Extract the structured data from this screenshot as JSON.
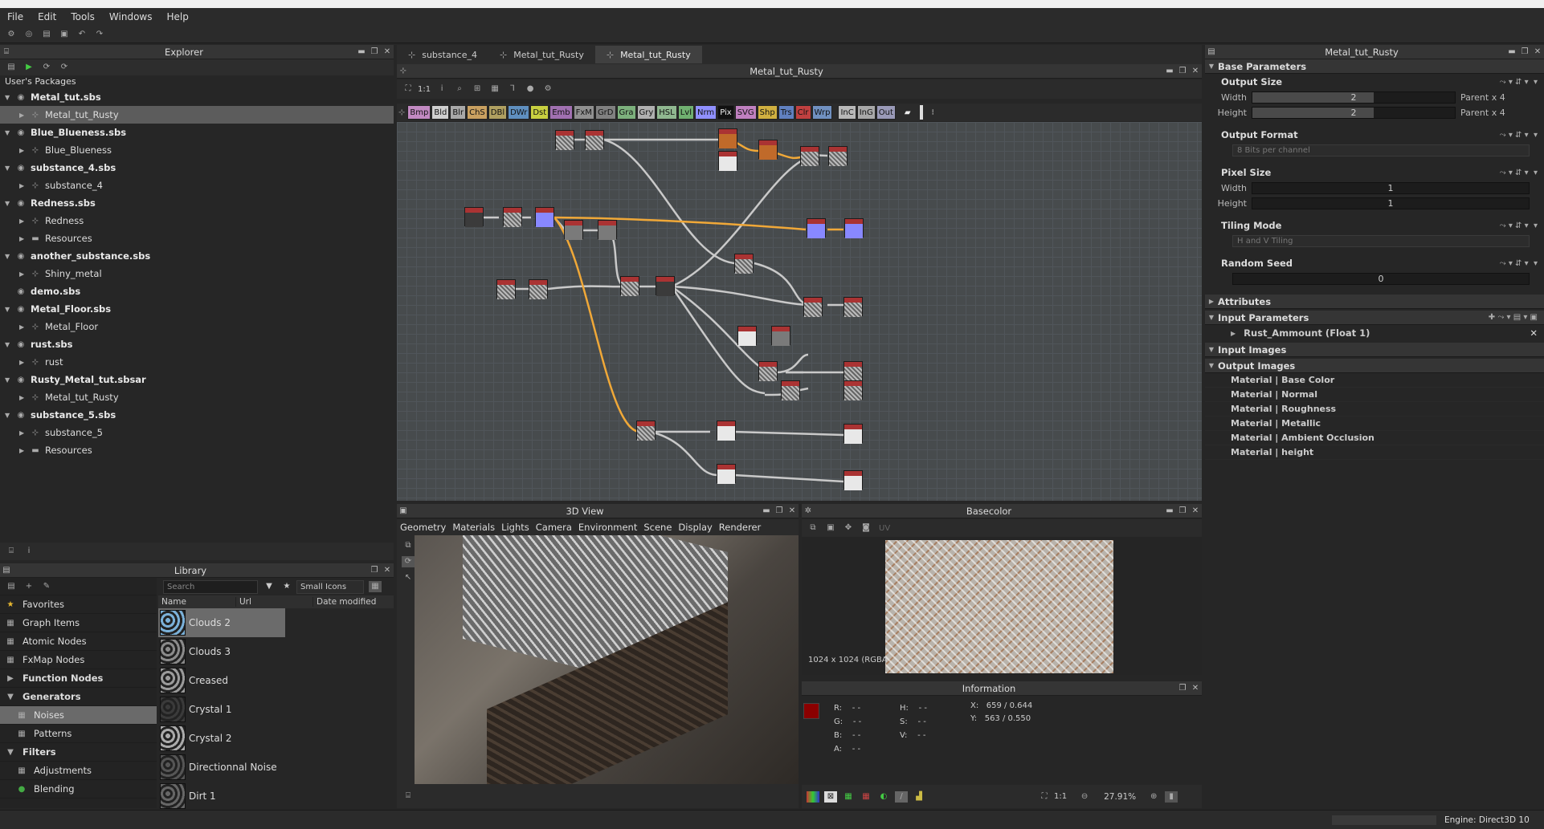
{
  "menu": [
    "File",
    "Edit",
    "Tools",
    "Windows",
    "Help"
  ],
  "explorer": {
    "title": "Explorer",
    "root": "User's Packages",
    "items": [
      {
        "label": "Metal_tut.sbs",
        "level": 0,
        "type": "pkg"
      },
      {
        "label": "Metal_tut_Rusty",
        "level": 1,
        "type": "graph",
        "selected": true
      },
      {
        "label": "Blue_Blueness.sbs",
        "level": 0,
        "type": "pkg"
      },
      {
        "label": "Blue_Blueness",
        "level": 1,
        "type": "graph"
      },
      {
        "label": "substance_4.sbs",
        "level": 0,
        "type": "pkg"
      },
      {
        "label": "substance_4",
        "level": 1,
        "type": "graph"
      },
      {
        "label": "Redness.sbs",
        "level": 0,
        "type": "pkg"
      },
      {
        "label": "Redness",
        "level": 1,
        "type": "graph"
      },
      {
        "label": "Resources",
        "level": 1,
        "type": "folder"
      },
      {
        "label": "another_substance.sbs",
        "level": 0,
        "type": "pkg"
      },
      {
        "label": "Shiny_metal",
        "level": 1,
        "type": "graph"
      },
      {
        "label": "demo.sbs",
        "level": 0,
        "type": "pkg",
        "noarrow": true
      },
      {
        "label": "Metal_Floor.sbs",
        "level": 0,
        "type": "pkg"
      },
      {
        "label": "Metal_Floor",
        "level": 1,
        "type": "graph"
      },
      {
        "label": "rust.sbs",
        "level": 0,
        "type": "pkg"
      },
      {
        "label": "rust",
        "level": 1,
        "type": "graph"
      },
      {
        "label": "Rusty_Metal_tut.sbsar",
        "level": 0,
        "type": "pkg"
      },
      {
        "label": "Metal_tut_Rusty",
        "level": 1,
        "type": "graph"
      },
      {
        "label": "substance_5.sbs",
        "level": 0,
        "type": "pkg"
      },
      {
        "label": "substance_5",
        "level": 1,
        "type": "graph"
      },
      {
        "label": "Resources",
        "level": 1,
        "type": "folder"
      }
    ]
  },
  "library": {
    "title": "Library",
    "search_placeholder": "Search",
    "view_mode": "Small Icons",
    "columns": [
      "Name",
      "Url",
      "Date modified"
    ],
    "categories": [
      {
        "label": "Favorites",
        "icon": "★"
      },
      {
        "label": "Graph Items",
        "icon": "▦"
      },
      {
        "label": "Atomic Nodes",
        "icon": "▦"
      },
      {
        "label": "FxMap Nodes",
        "icon": "▦"
      },
      {
        "label": "Function Nodes",
        "bold": true,
        "arrow": "▶"
      },
      {
        "label": "Generators",
        "bold": true,
        "arrow": "▼"
      },
      {
        "label": "Noises",
        "icon": "▦",
        "selected": true,
        "indent": true
      },
      {
        "label": "Patterns",
        "icon": "▦",
        "indent": true
      },
      {
        "label": "Filters",
        "bold": true,
        "arrow": "▼"
      },
      {
        "label": "Adjustments",
        "icon": "▦",
        "indent": true
      },
      {
        "label": "Blending",
        "icon": "●",
        "indent": true
      }
    ],
    "items": [
      {
        "label": "Clouds 2",
        "color": "#7ab0d8",
        "selected": true
      },
      {
        "label": "Clouds 3",
        "color": "#8a8a8a"
      },
      {
        "label": "Creased",
        "color": "#9a9a9a"
      },
      {
        "label": "Crystal 1",
        "color": "#3a3a3a"
      },
      {
        "label": "Crystal 2",
        "color": "#aaaaaa"
      },
      {
        "label": "Directionnal Noise",
        "color": "#555555"
      },
      {
        "label": "Dirt 1",
        "color": "#666666"
      }
    ]
  },
  "tabs": [
    {
      "label": "substance_4"
    },
    {
      "label": "Metal_tut_Rusty"
    },
    {
      "label": "Metal_tut_Rusty",
      "active": true
    }
  ],
  "graph": {
    "title": "Metal_tut_Rusty",
    "zoom": "1:1",
    "filters": [
      {
        "l": "Bmp",
        "c": "#c28ac2"
      },
      {
        "l": "Bld",
        "c": "#cfcfcf"
      },
      {
        "l": "Blr",
        "c": "#a8a8a8"
      },
      {
        "l": "ChS",
        "c": "#c9a060"
      },
      {
        "l": "DBl",
        "c": "#b0a060"
      },
      {
        "l": "DWr",
        "c": "#5f8fbf"
      },
      {
        "l": "Dst",
        "c": "#c8d040"
      },
      {
        "l": "Emb",
        "c": "#a070b0"
      },
      {
        "l": "FxM",
        "c": "#909090"
      },
      {
        "l": "GrD",
        "c": "#808080"
      },
      {
        "l": "Gra",
        "c": "#7cb07c"
      },
      {
        "l": "Gry",
        "c": "#b0b0b0"
      },
      {
        "l": "HSL",
        "c": "#90b890"
      },
      {
        "l": "Lvl",
        "c": "#70b070"
      },
      {
        "l": "Nrm",
        "c": "#9090ff"
      },
      {
        "l": "Pix",
        "c": "#111111",
        "fg": "#eee"
      },
      {
        "l": "SVG",
        "c": "#c080c0"
      },
      {
        "l": "Shp",
        "c": "#d0b040"
      },
      {
        "l": "Trs",
        "c": "#6080c0"
      },
      {
        "l": "Clr",
        "c": "#c04040"
      },
      {
        "l": "Wrp",
        "c": "#7090c0"
      },
      {
        "l": "InC",
        "c": "#b8b8b8"
      },
      {
        "l": "InG",
        "c": "#a8a8a8"
      },
      {
        "l": "Out",
        "c": "#9a9ab8"
      }
    ]
  },
  "view3d": {
    "title": "3D View",
    "menus": [
      "Geometry",
      "Materials",
      "Lights",
      "Camera",
      "Environment",
      "Scene",
      "Display",
      "Renderer"
    ]
  },
  "basecolor": {
    "title": "Basecolor",
    "uv": "UV",
    "resolution": "1024 x 1024 (RGBA",
    "zoom_ratio": "1:1",
    "zoom": "27.91%"
  },
  "information": {
    "title": "Information",
    "labels": [
      "R:",
      "G:",
      "B:",
      "A:",
      "H:",
      "S:",
      "V:"
    ],
    "dash": "- -",
    "x_label": "X:",
    "x_value": "659 / 0.644",
    "y_label": "Y:",
    "y_value": "563 / 0.550"
  },
  "props": {
    "title": "Metal_tut_Rusty",
    "base_section": "Base Parameters",
    "output_size": {
      "label": "Output Size",
      "width_label": "Width",
      "width_value": "2",
      "height_label": "Height",
      "height_value": "2",
      "relative": "Parent x 4"
    },
    "output_format": {
      "label": "Output Format",
      "value": "8 Bits per channel"
    },
    "pixel_size": {
      "label": "Pixel Size",
      "width_label": "Width",
      "width_value": "1",
      "height_label": "Height",
      "height_value": "1"
    },
    "tiling": {
      "label": "Tiling Mode",
      "value": "H and V Tiling"
    },
    "seed": {
      "label": "Random Seed",
      "value": "0"
    },
    "sections": [
      "Attributes",
      "Input Parameters",
      "Input Images",
      "Output Images"
    ],
    "input_param": "Rust_Ammount (Float 1)",
    "outputs": [
      "Material | Base Color",
      "Material | Normal",
      "Material | Roughness",
      "Material | Metallic",
      "Material | Ambient Occlusion",
      "Material | height"
    ]
  },
  "status": {
    "engine": "Engine: Direct3D 10"
  }
}
